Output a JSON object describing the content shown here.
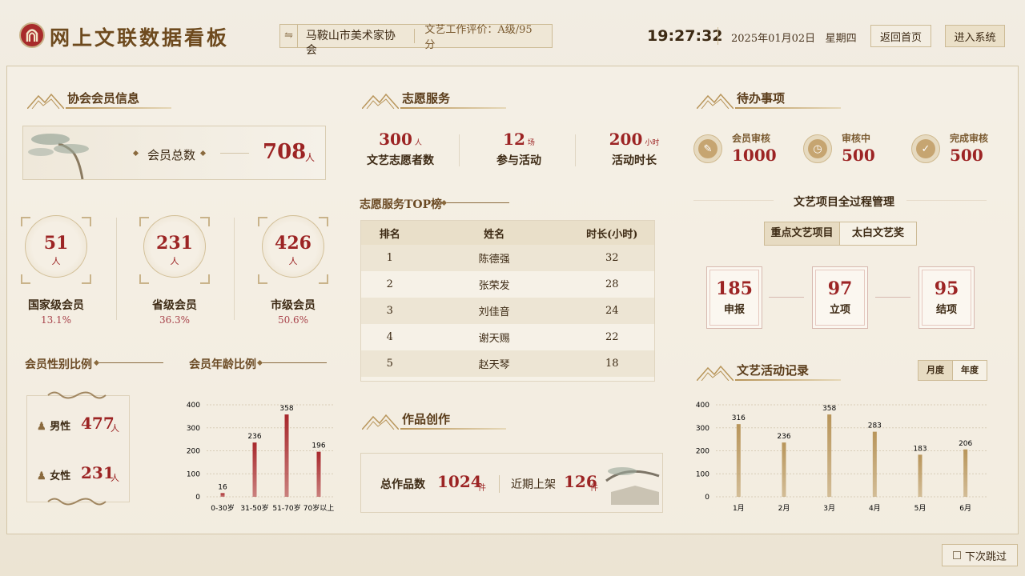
{
  "header": {
    "title": "网上文联数据看板",
    "org": "马鞍山市美术家协会",
    "eval": "文艺工作评价：A级/95分",
    "time": "19:27:32",
    "date": "2025年01月02日",
    "weekday": "星期四",
    "btn_home": "返回首页",
    "btn_enter": "进入系统"
  },
  "members": {
    "title": "协会会员信息",
    "total_label": "会员总数",
    "total": "708",
    "unit": "人",
    "levels": [
      {
        "value": "51",
        "label": "国家级会员",
        "pct": "13.1%"
      },
      {
        "value": "231",
        "label": "省级会员",
        "pct": "36.3%"
      },
      {
        "value": "426",
        "label": "市级会员",
        "pct": "50.6%"
      }
    ],
    "gender_title": "会员性别比例",
    "male_label": "男性",
    "male": "477",
    "female_label": "女性",
    "female": "231",
    "age_title": "会员年龄比例"
  },
  "volunteer": {
    "title": "志愿服务",
    "stats": [
      {
        "value": "300",
        "unit": "人",
        "label": "文艺志愿者数"
      },
      {
        "value": "12",
        "unit": "场",
        "label": "参与活动"
      },
      {
        "value": "200",
        "unit": "小时",
        "label": "活动时长"
      }
    ],
    "top_title": "志愿服务TOP榜",
    "headers": [
      "排名",
      "姓名",
      "时长(小时)"
    ],
    "rows": [
      [
        "1",
        "陈德强",
        "32"
      ],
      [
        "2",
        "张荣发",
        "28"
      ],
      [
        "3",
        "刘佳音",
        "24"
      ],
      [
        "4",
        "谢天赐",
        "22"
      ],
      [
        "5",
        "赵天琴",
        "18"
      ]
    ]
  },
  "works": {
    "title": "作品创作",
    "total_label": "总作品数",
    "total": "1024",
    "recent_label": "近期上架",
    "recent": "126",
    "unit": "件"
  },
  "todo": {
    "title": "待办事项",
    "items": [
      {
        "label": "会员审核",
        "value": "1000"
      },
      {
        "label": "审核中",
        "value": "500"
      },
      {
        "label": "完成审核",
        "value": "500"
      }
    ],
    "project_title": "文艺项目全过程管理",
    "tabs": [
      "重点文艺项目",
      "太白文艺奖"
    ],
    "flow": [
      {
        "value": "185",
        "label": "申报"
      },
      {
        "value": "97",
        "label": "立项"
      },
      {
        "value": "95",
        "label": "结项"
      }
    ]
  },
  "activity": {
    "title": "文艺活动记录",
    "tabs": [
      "月度",
      "年度"
    ]
  },
  "footer": {
    "skip": "下次跳过"
  },
  "chart_data": [
    {
      "type": "bar",
      "categories": [
        "0-30岁",
        "31-50岁",
        "51-70岁",
        "70岁以上"
      ],
      "values": [
        16,
        236,
        358,
        196
      ],
      "ylim": [
        0,
        400
      ],
      "yticks": [
        0,
        100,
        200,
        300,
        400
      ],
      "color": "#a8282c"
    },
    {
      "type": "bar",
      "categories": [
        "1月",
        "2月",
        "3月",
        "4月",
        "5月",
        "6月"
      ],
      "values": [
        316,
        236,
        358,
        283,
        183,
        206
      ],
      "ylim": [
        0,
        400
      ],
      "yticks": [
        0,
        100,
        200,
        300,
        400
      ],
      "color": "#b8955a"
    }
  ]
}
